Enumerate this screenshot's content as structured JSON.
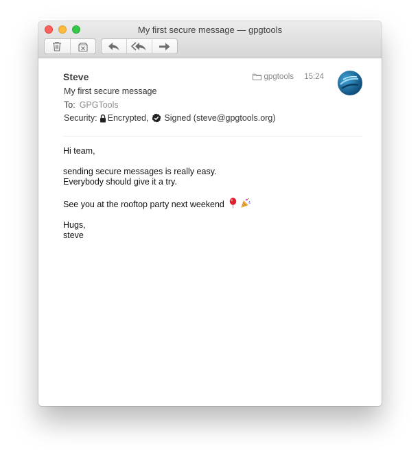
{
  "window": {
    "title": "My first secure message  — gpgtools"
  },
  "toolbar": {
    "buttons": [
      {
        "icon": "trash-icon"
      },
      {
        "icon": "junk-icon"
      },
      {
        "icon": "reply-icon"
      },
      {
        "icon": "reply-all-icon"
      },
      {
        "icon": "forward-icon"
      }
    ]
  },
  "message": {
    "sender": "Steve",
    "subject": "My first secure message",
    "to_label": "To:",
    "recipient": "GPGTools",
    "security_label": "Security:",
    "encrypted_label": "Encrypted,",
    "signed_label": "Signed (steve@gpgtools.org)",
    "mailbox": "gpgtools",
    "time": "15:24"
  },
  "body": {
    "greeting": "Hi team,",
    "line1": "sending secure messages is really easy.",
    "line2": "Everybody should give it a try.",
    "line3": "See you at the rooftop party next weekend",
    "signoff": "Hugs,",
    "signature": "steve"
  },
  "colors": {
    "accent_close": "#fc605c",
    "accent_minimize": "#fdbc40",
    "accent_zoom": "#34c84a"
  }
}
